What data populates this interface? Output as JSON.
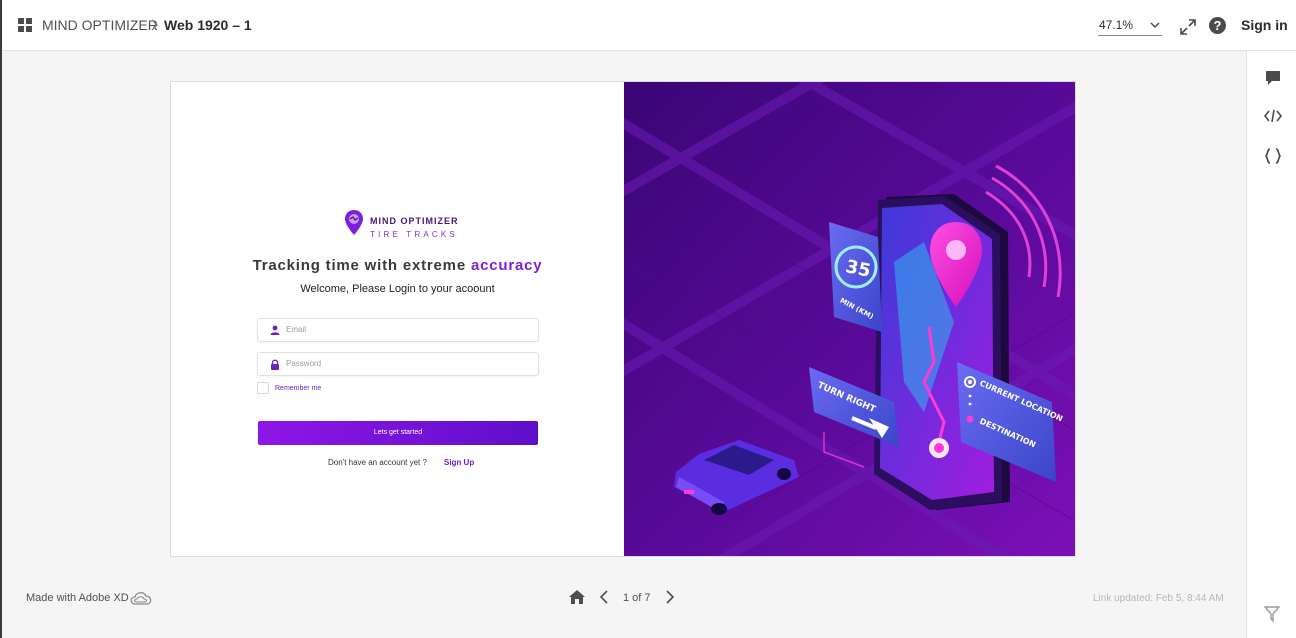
{
  "header": {
    "crumb_root": "MIND OPTIMIZER",
    "crumb_current": "Web 1920 – 1",
    "zoom": "47.1%",
    "sign_in": "Sign in"
  },
  "artboard": {
    "logo_name": "MIND OPTIMIZER",
    "logo_sub": "TIRE TRACKS",
    "headline_prefix": "Tracking time with extreme ",
    "headline_accent": "accuracy",
    "welcome": "Welcome, Please Login to your acoount",
    "email_placeholder": "Email",
    "password_placeholder": "Password",
    "remember": "Remember me",
    "cta": "Lets get started",
    "no_account": "Don't have an account yet ?",
    "signup": "Sign Up",
    "hero": {
      "speed_value": "35",
      "speed_unit": "MIN (KM)",
      "turn_label": "TURN RIGHT",
      "current_location": "CURRENT LOCATION",
      "destination": "DESTINATION"
    }
  },
  "footer": {
    "made_with": "Made with Adobe XD",
    "page_info": "1 of 7",
    "updated": "Link updated: Feb 5, 8:44 AM"
  },
  "colors": {
    "accent": "#7b1fd8",
    "hero_bg": "#5a0a9a",
    "pin": "#ff2bd8",
    "cta_start": "#8f16e6",
    "cta_end": "#5f0fc9"
  }
}
